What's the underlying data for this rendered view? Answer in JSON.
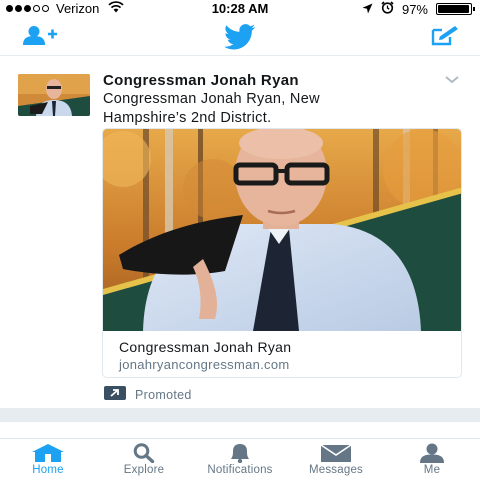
{
  "status_bar": {
    "carrier": "Verizon",
    "time": "10:28 AM",
    "battery_percent_label": "97%",
    "battery_level": 0.97,
    "signal_bars_filled": 3,
    "signal_bars_total": 5
  },
  "nav": {
    "add_user_icon": "add-user-icon",
    "logo_icon": "twitter-bird-icon",
    "compose_icon": "compose-tweet-icon"
  },
  "tweet": {
    "author": "Congressman Jonah Ryan",
    "text": "Congressman Jonah Ryan, New Hampshire’s 2nd District.",
    "card": {
      "title": "Congressman Jonah Ryan",
      "url": "jonahryancongressman.com"
    },
    "promoted_label": "Promoted"
  },
  "tabs": [
    {
      "label": "Home",
      "icon": "home-icon",
      "active": true
    },
    {
      "label": "Explore",
      "icon": "search-icon",
      "active": false
    },
    {
      "label": "Notifications",
      "icon": "bell-icon",
      "active": false
    },
    {
      "label": "Messages",
      "icon": "envelope-icon",
      "active": false
    },
    {
      "label": "Me",
      "icon": "person-icon",
      "active": false
    }
  ],
  "colors": {
    "accent": "#1da1f2",
    "muted": "#657786",
    "separator": "#e6ecf0",
    "card_green": "#1e4d3f"
  }
}
